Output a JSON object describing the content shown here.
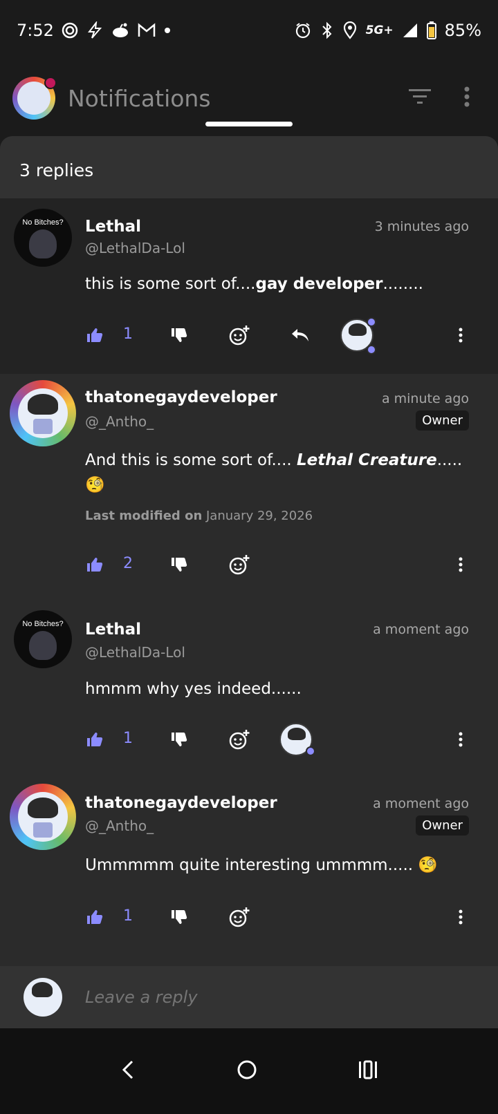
{
  "status": {
    "time": "7:52",
    "network": "5G+",
    "battery": "85%"
  },
  "app_bar": {
    "title": "Notifications"
  },
  "sheet": {
    "header": "3 replies"
  },
  "comments": [
    {
      "name": "Lethal",
      "handle": "@LethalDa-Lol",
      "time": "3 minutes ago",
      "avatar_caption": "No Bitches?",
      "text_plain": "this is some sort of....",
      "text_bold": "gay developer",
      "text_tail": "........",
      "likes": "1"
    },
    {
      "name": "thatonegaydeveloper",
      "handle": "@_Antho_",
      "time": "a minute ago",
      "badge": "Owner",
      "text_plain": "And this is some sort of.... ",
      "text_bold": "Lethal Creature",
      "text_tail": ".....",
      "emoji": "🧐",
      "modified_label": "Last modified on",
      "modified_date": "January 29, 2026",
      "likes": "2"
    },
    {
      "name": "Lethal",
      "handle": "@LethalDa-Lol",
      "time": "a moment ago",
      "avatar_caption": "No Bitches?",
      "text": "hmmm why yes indeed......",
      "likes": "1"
    },
    {
      "name": "thatonegaydeveloper",
      "handle": "@_Antho_",
      "time": "a moment ago",
      "badge": "Owner",
      "text": "Ummmmm quite interesting ummmm.....",
      "emoji": "🧐",
      "likes": "1"
    }
  ],
  "reply": {
    "placeholder": "Leave a reply"
  },
  "colors": {
    "accent": "#8c8cff",
    "sheet": "#2b2b2b",
    "highlight_row": "#232323"
  }
}
